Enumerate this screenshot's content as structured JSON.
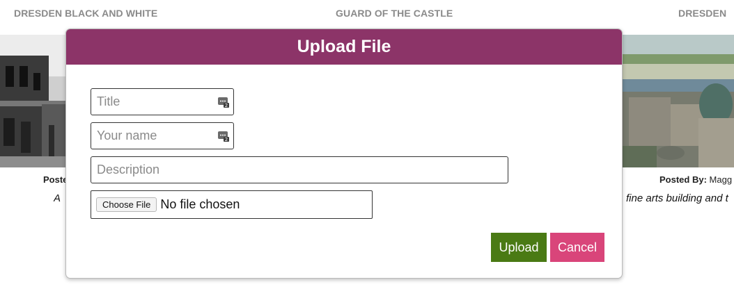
{
  "gallery": {
    "titles": [
      "DRESDEN BLACK AND WHITE",
      "GUARD OF THE CASTLE",
      "DRESDEN"
    ],
    "left_posted_label": "Poste",
    "left_caption": "A",
    "right_posted_label": "Posted By:",
    "right_posted_name": "Magg",
    "right_caption": "fine arts building and t"
  },
  "modal": {
    "title": "Upload File",
    "title_placeholder": "Title",
    "name_placeholder": "Your name",
    "description_placeholder": "Description",
    "file_button_label": "Choose File",
    "file_status": "No file chosen",
    "upload_label": "Upload",
    "cancel_label": "Cancel"
  },
  "colors": {
    "header": "#8c3468",
    "upload": "#4a7a14",
    "cancel": "#d9457a"
  },
  "icons": {
    "field_icon": "chat-badge-icon"
  }
}
